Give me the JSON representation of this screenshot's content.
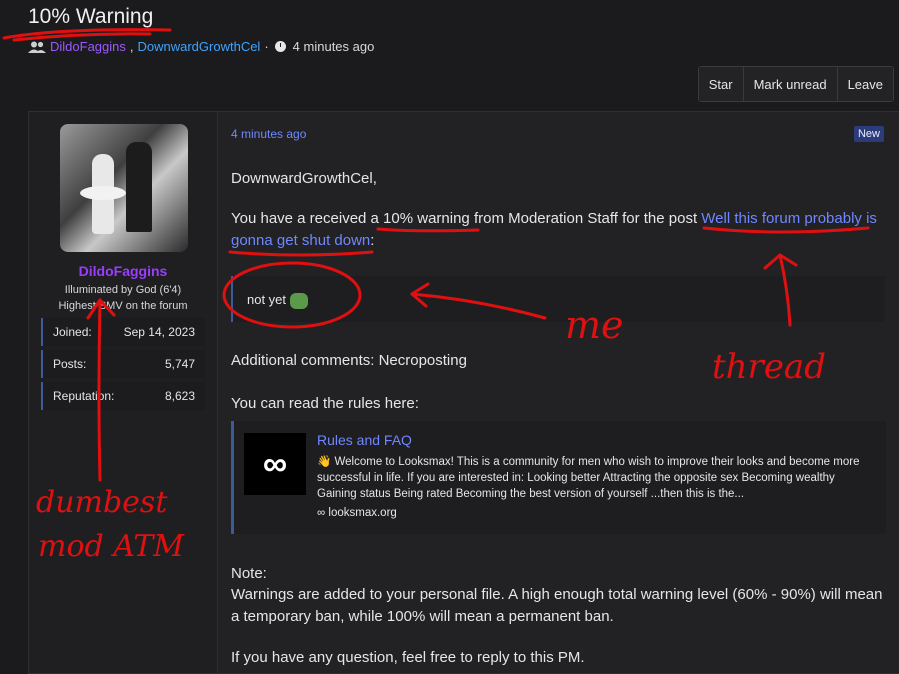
{
  "thread": {
    "title": "10% Warning",
    "participants": [
      "DildoFaggins",
      "DownwardGrowthCel"
    ],
    "time": "4 minutes ago"
  },
  "actions": [
    "Star",
    "Mark unread",
    "Leave"
  ],
  "user": {
    "name": "DildoFaggins",
    "title1": "Illuminated by God (6'4)",
    "title2": "Highest SMV on the forum",
    "stats": [
      {
        "label": "Joined:",
        "value": "Sep 14, 2023"
      },
      {
        "label": "Posts:",
        "value": "5,747"
      },
      {
        "label": "Reputation:",
        "value": "8,623"
      }
    ]
  },
  "message": {
    "time": "4 minutes ago",
    "badge": "New",
    "greeting": "DownwardGrowthCel,",
    "warn_pre": "You have a received a 10% warning from Moderation Staff for the post ",
    "warn_link": "Well this forum probably is gonna get shut down",
    "warn_post": ":",
    "quote": "not yet",
    "comments": "Additional comments: Necroposting",
    "rules_intro": "You can read the rules here:",
    "embed": {
      "title": "Rules and FAQ",
      "desc": "👋 Welcome to Looksmax! This is a community for men who wish to improve their looks and become more successful in life. If you are interested in: Looking better Attracting the opposite sex Becoming wealthy Gaining status Being rated Becoming the best version of yourself ...then this is the...",
      "domain": "looksmax.org",
      "logo": "∞"
    },
    "note_label": "Note:",
    "note": "Warnings are added to your personal file. A high enough total warning level (60% - 90%) will mean a temporary ban, while 100% will mean a permanent ban.",
    "closing": "If you have any question, feel free to reply to this PM."
  },
  "annotations": {
    "me": "me",
    "thread": "thread",
    "mod1": "dumbest",
    "mod2": "mod ATM"
  }
}
